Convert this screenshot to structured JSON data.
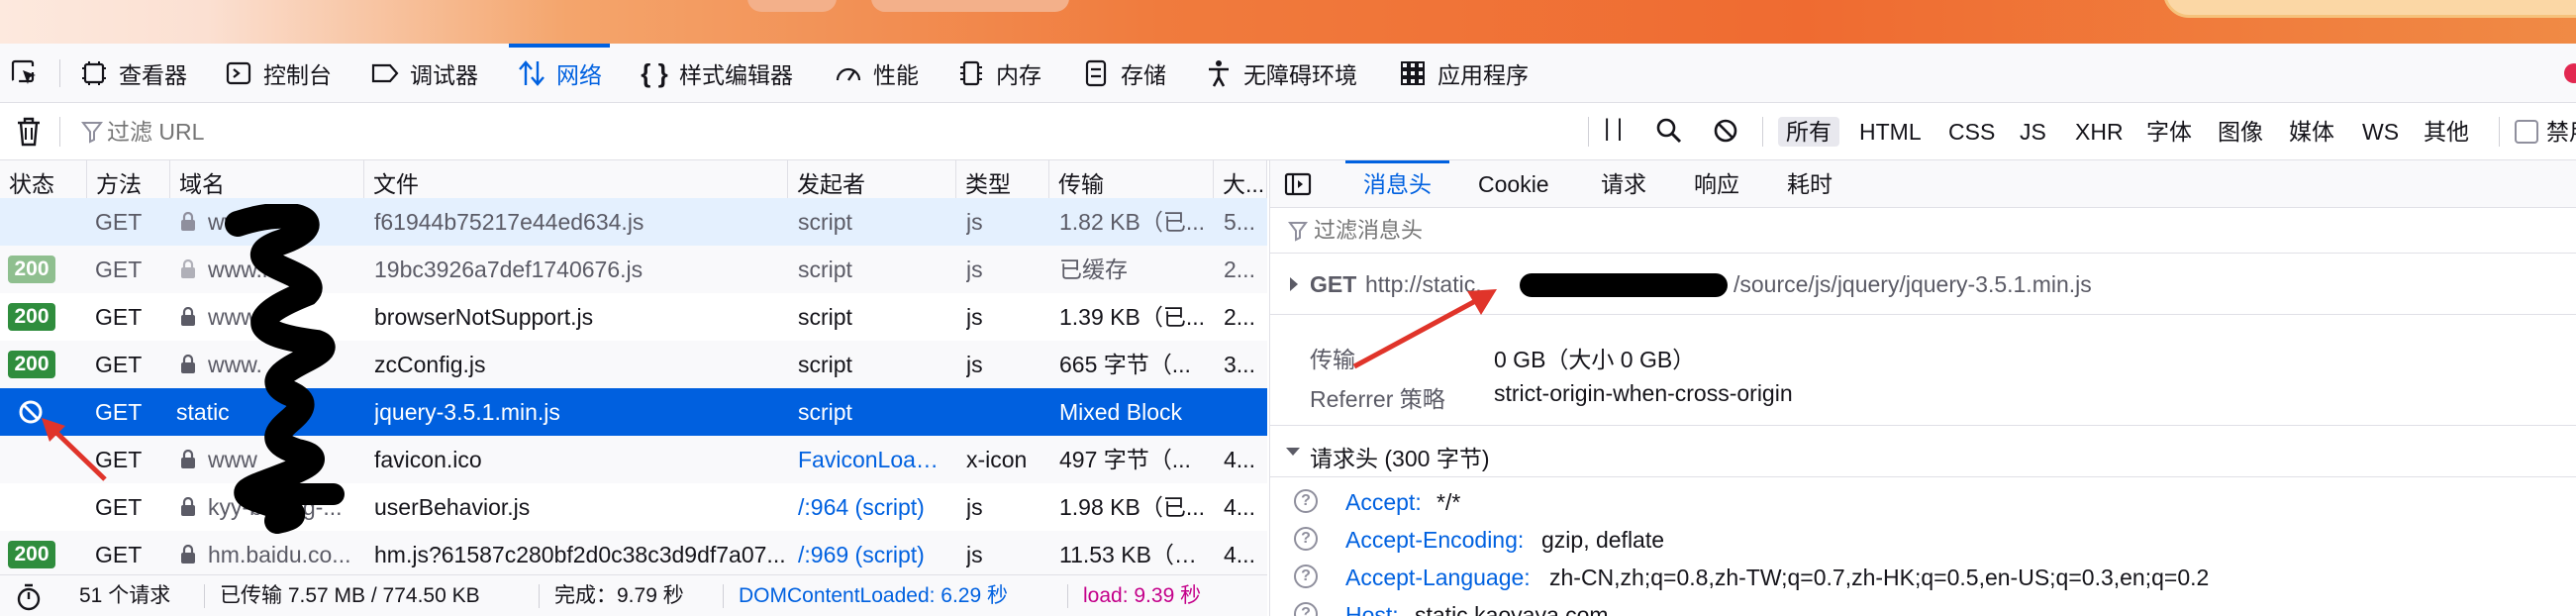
{
  "toolbar": {
    "tabs": [
      {
        "label": "查看器",
        "icon": "inspector-icon"
      },
      {
        "label": "控制台",
        "icon": "console-icon"
      },
      {
        "label": "调试器",
        "icon": "debugger-icon"
      },
      {
        "label": "网络",
        "icon": "network-icon",
        "active": true
      },
      {
        "label": "样式编辑器",
        "icon": "style-editor-icon"
      },
      {
        "label": "性能",
        "icon": "performance-icon"
      },
      {
        "label": "内存",
        "icon": "memory-icon"
      },
      {
        "label": "存储",
        "icon": "storage-icon"
      },
      {
        "label": "无障碍环境",
        "icon": "accessibility-icon"
      },
      {
        "label": "应用程序",
        "icon": "application-icon"
      }
    ]
  },
  "filter": {
    "placeholder": "过滤 URL",
    "types": [
      "所有",
      "HTML",
      "CSS",
      "JS",
      "XHR",
      "字体",
      "图像",
      "媒体",
      "WS",
      "其他"
    ],
    "selected": "所有",
    "disable_cache": "禁用"
  },
  "table": {
    "headers": [
      "状态",
      "方法",
      "域名",
      "文件",
      "发起者",
      "类型",
      "传输",
      "大..."
    ],
    "rows": [
      {
        "status": "",
        "method": "GET",
        "domain": "www.",
        "file": "f61944b75217e44ed634.js",
        "initiator": "script",
        "type": "js",
        "transfer": "1.82 KB（已...",
        "size": "5..."
      },
      {
        "status": "200",
        "method": "GET",
        "domain": "www.l",
        "file": "19bc3926a7def1740676.js",
        "initiator": "script",
        "type": "js",
        "transfer": "已缓存",
        "size": "2..."
      },
      {
        "status": "200",
        "method": "GET",
        "domain": "www.",
        "file": "browserNotSupport.js",
        "initiator": "script",
        "type": "js",
        "transfer": "1.39 KB（已...",
        "size": "2..."
      },
      {
        "status": "200",
        "method": "GET",
        "domain": "www.",
        "file": "zcConfig.js",
        "initiator": "script",
        "type": "js",
        "transfer": "665 字节（...",
        "size": "3..."
      },
      {
        "status": "blocked",
        "method": "GET",
        "domain": "static",
        "file": "jquery-3.5.1.min.js",
        "initiator": "script",
        "type": "",
        "transfer": "Mixed Block",
        "size": ""
      },
      {
        "status": "",
        "method": "GET",
        "domain": "www",
        "file": "favicon.ico",
        "initiator": "FaviconLoad...",
        "type": "x-icon",
        "transfer": "497 字节（...",
        "size": "4..."
      },
      {
        "status": "",
        "method": "GET",
        "domain": "kyy-beijing-...",
        "file": "userBehavior.js",
        "initiator": "/:964 (script)",
        "type": "js",
        "transfer": "1.98 KB（已...",
        "size": "4..."
      },
      {
        "status": "200",
        "method": "GET",
        "domain": "hm.baidu.co...",
        "file": "hm.js?61587c280bf2d0c38c3d9df7a07...",
        "initiator": "/:969 (script)",
        "type": "js",
        "transfer": "11.53 KB（已...",
        "size": "4..."
      }
    ]
  },
  "statusbar": {
    "requests": "51 个请求",
    "transferred": "已传输 7.57 MB / 774.50 KB",
    "finish": "完成：9.79 秒",
    "dcl": "DOMContentLoaded: 6.29 秒",
    "load": "load: 9.39 秒"
  },
  "panel": {
    "tabs": [
      "消息头",
      "Cookie",
      "请求",
      "响应",
      "耗时"
    ],
    "active_tab": "消息头",
    "filter_placeholder": "过滤消息头",
    "request_method": "GET",
    "request_url_prefix": "http://static.",
    "request_url_suffix": "/source/js/jquery/jquery-3.5.1.min.js",
    "transfer_label": "传输",
    "transfer_value": "0 GB（大小 0 GB）",
    "referrer_label": "Referrer 策略",
    "referrer_value": "strict-origin-when-cross-origin",
    "request_headers_title": "请求头 (300 字节)",
    "headers": [
      {
        "name": "Accept:",
        "value": "*/*"
      },
      {
        "name": "Accept-Encoding:",
        "value": "gzip, deflate"
      },
      {
        "name": "Accept-Language:",
        "value": "zh-CN,zh;q=0.8,zh-TW;q=0.7,zh-HK;q=0.5,en-US;q=0.3,en;q=0.2"
      },
      {
        "name": "Host:",
        "value": "static.kaoyaya.com"
      }
    ]
  },
  "colors": {
    "accent": "#0061e0",
    "status_ok": "#2f8d3d",
    "selected_row": "#0060df",
    "annotation_arrow": "#e0342a",
    "load_text": "#c4008a"
  }
}
